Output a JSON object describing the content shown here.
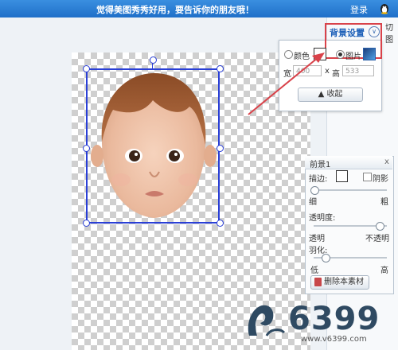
{
  "topbar": {
    "message": "觉得美图秀秀好用，要告诉你的朋友哦！",
    "login": "登录"
  },
  "right_tab": "切图",
  "bg_settings": {
    "title": "背景设置",
    "color_label": "颜色",
    "image_label": "图片",
    "selected": "image",
    "width_label": "宽",
    "width_value": "400",
    "times": "x",
    "height_label": "高",
    "height_value": "533",
    "collapse_label": "收起"
  },
  "foreground": {
    "title": "前景1",
    "close": "x",
    "stroke_label": "描边:",
    "shadow_label": "阴影",
    "thin": "细",
    "thick": "粗",
    "opacity_label": "透明度:",
    "opaque_from": "透明",
    "opaque_to": "不透明",
    "feather_label": "羽化:",
    "low": "低",
    "high": "高",
    "delete_label": "删除本素材"
  },
  "watermark": {
    "brand": "6399",
    "url": "www.v6399.com"
  },
  "colors": {
    "accent": "#1f6fc8",
    "highlight": "#d9424a",
    "selection": "#2a3fd6"
  }
}
